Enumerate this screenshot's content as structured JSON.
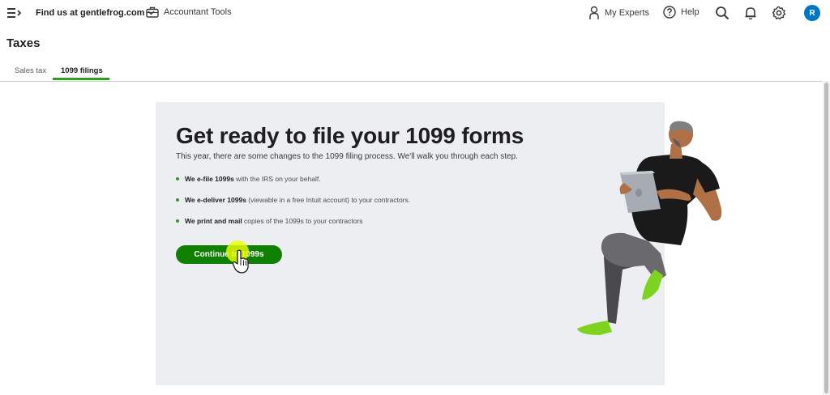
{
  "topbar": {
    "company": "Find us at gentlefrog.com",
    "accountant_tools": "Accountant Tools",
    "my_experts": "My Experts",
    "help": "Help",
    "avatar_initial": "R",
    "icons": [
      "menu-toggle-icon",
      "chevron-down-icon",
      "briefcase-icon",
      "person-icon",
      "help-icon",
      "search-icon",
      "bell-icon",
      "gear-icon"
    ]
  },
  "page": {
    "title": "Taxes",
    "tabs": [
      {
        "label": "Sales tax",
        "active": false
      },
      {
        "label": "1099 filings",
        "active": true
      }
    ]
  },
  "card": {
    "headline": "Get ready to file your 1099 forms",
    "subline": "This year, there are some changes to the 1099 filing process. We'll walk you through each step.",
    "bullets": [
      {
        "bold": "We e-file 1099s",
        "rest": " with the IRS on your behalf."
      },
      {
        "bold": "We e-deliver 1099s",
        "rest": " (viewable in a free Intuit account) to your contractors."
      },
      {
        "bold": "We print and mail",
        "rest": " copies of the 1099s to your contractors"
      }
    ],
    "cta_label": "Continue to 1099s"
  },
  "colors": {
    "accent_green": "#2ca01c",
    "cta_green": "#108000",
    "avatar_blue": "#0077c5",
    "card_bg": "#eceef1",
    "cursor_highlight": "#edff00"
  }
}
